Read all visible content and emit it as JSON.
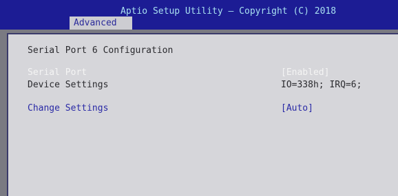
{
  "header": {
    "title": "Aptio Setup Utility – Copyright (C) 2018",
    "active_tab": "Advanced"
  },
  "panel": {
    "section_title": "Serial Port 6 Configuration",
    "serial_port": {
      "label": "Serial Port",
      "value": "[Enabled]"
    },
    "device_settings": {
      "label": "Device Settings",
      "value": "IO=338h; IRQ=6;"
    },
    "change_settings": {
      "label": "Change Settings",
      "value": "[Auto]"
    }
  },
  "colors": {
    "header_bg": "#1c1c94",
    "title_text": "#a8e0f0",
    "panel_bg": "#d6d6da",
    "selectable_text": "#2a2aa6",
    "highlight_text": "#f4f4f4"
  }
}
